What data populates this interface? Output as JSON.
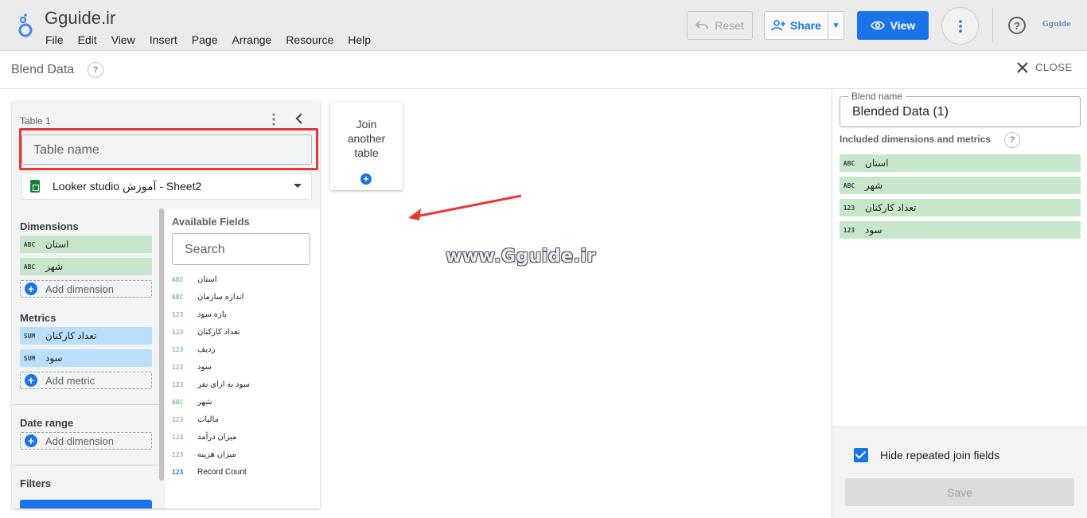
{
  "app": {
    "title": "Gguide.ir",
    "menu": [
      "File",
      "Edit",
      "View",
      "Insert",
      "Page",
      "Arrange",
      "Resource",
      "Help"
    ],
    "reset_label": "Reset",
    "share_label": "Share",
    "view_label": "View",
    "brand_text": "Gguide",
    "accent_color": "#1a73e8"
  },
  "blend": {
    "title": "Blend Data",
    "help_glyph": "?",
    "close_label": "CLOSE"
  },
  "table": {
    "label": "Table 1",
    "name_placeholder": "Table name",
    "source": "Looker studio آموزش - Sheet2",
    "dimensions_title": "Dimensions",
    "dimensions": [
      {
        "type": "ABC",
        "name": "استان"
      },
      {
        "type": "ABC",
        "name": "شهر"
      }
    ],
    "add_dimension_label": "Add dimension",
    "metrics_title": "Metrics",
    "metrics": [
      {
        "type": "SUM",
        "name": "تعداد کارکنان"
      },
      {
        "type": "SUM",
        "name": "سود"
      }
    ],
    "add_metric_label": "Add metric",
    "date_range_title": "Date range",
    "add_date_dimension_label": "Add dimension",
    "filters_title": "Filters",
    "available_title": "Available Fields",
    "search_placeholder": "Search",
    "available_fields": [
      {
        "type": "ABC",
        "name": "استان"
      },
      {
        "type": "ABC",
        "name": "اندازه سازمان"
      },
      {
        "type": "123",
        "name": "بازه سود"
      },
      {
        "type": "123",
        "name": "تعداد کارکنان"
      },
      {
        "type": "123",
        "name": "ردیف"
      },
      {
        "type": "123",
        "name": "سود"
      },
      {
        "type": "123",
        "name": "سود به ازای نفر"
      },
      {
        "type": "ABC",
        "name": "شهر"
      },
      {
        "type": "123",
        "name": "مالیات"
      },
      {
        "type": "123",
        "name": "میزان درآمد"
      },
      {
        "type": "123",
        "name": "میزان هزینه"
      },
      {
        "type": "123",
        "name": "Record Count"
      }
    ]
  },
  "join": {
    "line1": "Join",
    "line2": "another",
    "line3": "table",
    "plus_glyph": "+"
  },
  "watermark": "www.Gguide.ir",
  "panel": {
    "blend_name_label": "Blend name",
    "blend_name_value": "Blended Data (1)",
    "included_title": "Included dimensions and metrics",
    "included": [
      {
        "type": "ABC",
        "name": "استان"
      },
      {
        "type": "ABC",
        "name": "شهر"
      },
      {
        "type": "123",
        "name": "تعداد کارکنان"
      },
      {
        "type": "123",
        "name": "سود"
      }
    ],
    "hide_repeated_label": "Hide repeated join fields",
    "hide_repeated_checked": true,
    "save_label": "Save"
  }
}
